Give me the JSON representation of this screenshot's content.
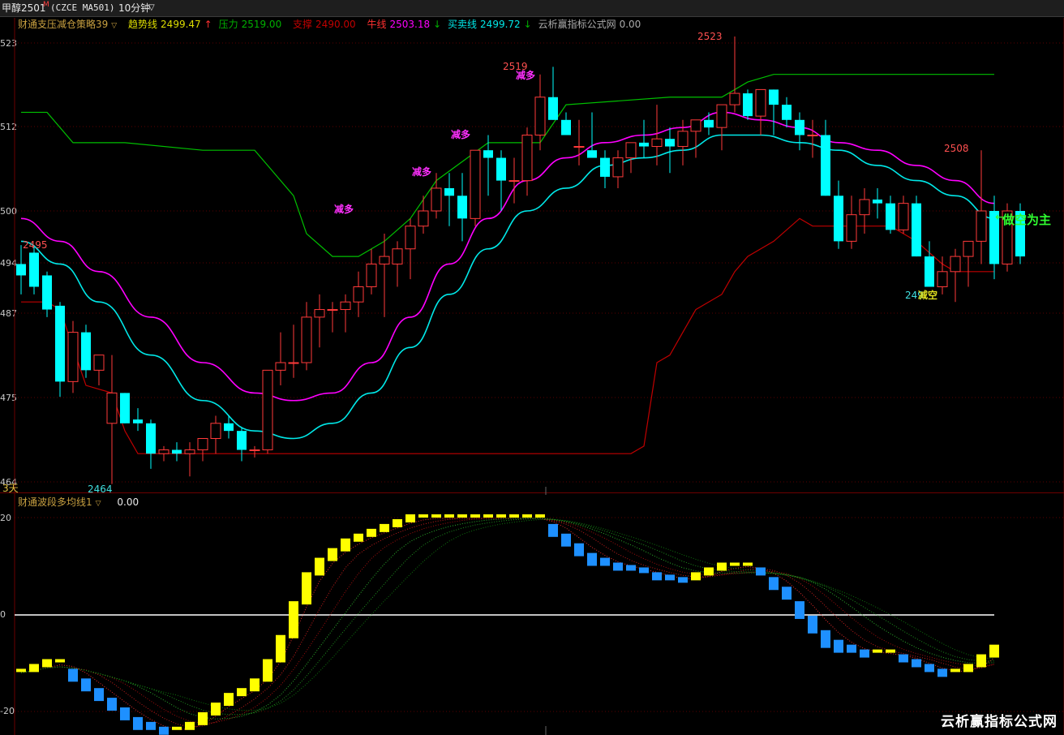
{
  "topbar": {
    "symbol": "甲醇2501",
    "badge": "M",
    "code": "(CZCE MA501)",
    "period": "10分钟"
  },
  "legend_main": {
    "name": "财通支压减仓策略39",
    "trend_label": "趋势线",
    "trend_value": "2499.47",
    "resist_label": "压力",
    "resist_value": "2519.00",
    "support_label": "支撑",
    "support_value": "2490.00",
    "bull_label": "牛线",
    "bull_value": "2503.18",
    "trade_label": "买卖线",
    "trade_value": "2499.72",
    "source_label": "云析赢指标公式网",
    "source_value": "0.00"
  },
  "legend_sub": {
    "name": "财通波段多均线1",
    "value": "0.00"
  },
  "ylabels_main": [
    "523",
    "512",
    "500",
    "494",
    "487",
    "475",
    "464"
  ],
  "ylabels_sub": [
    "20",
    "0",
    "-20"
  ],
  "annotations": {
    "high_2495": "2495",
    "low_2464": "2464",
    "high_2519": "2519",
    "high_2523": "2523",
    "high_2508": "2508",
    "low_right": "249",
    "reduce_long": "减多",
    "reduce_short": "减空",
    "short_main": "做空为主",
    "days": "3天"
  },
  "watermark": "云析赢指标公式网",
  "colors": {
    "up": "#ff3a3a",
    "down": "#00ffff",
    "trend": "#00c000",
    "resist": "#c00000",
    "bull": "#ff00ff",
    "trade": "#00e8e8",
    "barUp": "#ffff00",
    "barDown": "#1e90ff"
  },
  "chart_data": {
    "type": "candlestick",
    "ohlc": [
      [
        2493,
        2495.5,
        2489,
        2491.5
      ],
      [
        2494.5,
        2495.5,
        2489,
        2490
      ],
      [
        2491.5,
        2492,
        2486,
        2487
      ],
      [
        2487.5,
        2488,
        2475.5,
        2477.5
      ],
      [
        2477.5,
        2485.5,
        2476,
        2484
      ],
      [
        2484,
        2485,
        2478,
        2479
      ],
      [
        2479,
        2480,
        2477,
        2481
      ],
      [
        2472,
        2481,
        2464,
        2476
      ],
      [
        2476,
        2476,
        2472,
        2472
      ],
      [
        2472.5,
        2474,
        2471,
        2472
      ],
      [
        2472,
        2472.5,
        2466,
        2468
      ],
      [
        2468,
        2469,
        2467,
        2468.5
      ],
      [
        2468.5,
        2469.5,
        2467,
        2468
      ],
      [
        2468,
        2469.5,
        2465,
        2468.5
      ],
      [
        2468.5,
        2470,
        2467,
        2470
      ],
      [
        2470,
        2473,
        2468,
        2472
      ],
      [
        2472,
        2473,
        2470,
        2471
      ],
      [
        2471,
        2471.5,
        2467,
        2468.5
      ],
      [
        2468.5,
        2469,
        2467.5,
        2468.5
      ],
      [
        2468.5,
        2479,
        2468,
        2479
      ],
      [
        2479,
        2484,
        2477,
        2480
      ],
      [
        2480,
        2485,
        2478,
        2480
      ],
      [
        2480,
        2488,
        2479,
        2486
      ],
      [
        2486,
        2489,
        2482,
        2487
      ],
      [
        2487,
        2488,
        2484,
        2487
      ],
      [
        2487,
        2489,
        2484,
        2488
      ],
      [
        2488,
        2492,
        2486,
        2490
      ],
      [
        2490,
        2495,
        2489,
        2493
      ],
      [
        2493,
        2497,
        2486,
        2494
      ],
      [
        2493,
        2496,
        2490,
        2495
      ],
      [
        2495,
        2499,
        2491,
        2498
      ],
      [
        2498,
        2502,
        2497,
        2500
      ],
      [
        2500,
        2505,
        2499,
        2503
      ],
      [
        2503,
        2505,
        2498,
        2502
      ],
      [
        2502,
        2505,
        2496,
        2499
      ],
      [
        2499,
        2506,
        2498,
        2508
      ],
      [
        2508,
        2510,
        2502,
        2507
      ],
      [
        2507,
        2508,
        2500,
        2504
      ],
      [
        2504,
        2507,
        2501,
        2504
      ],
      [
        2504,
        2511,
        2502,
        2510
      ],
      [
        2510,
        2518,
        2508,
        2515
      ],
      [
        2515,
        2519,
        2512,
        2512
      ],
      [
        2512,
        2513,
        2510,
        2510
      ],
      [
        2508.5,
        2512,
        2506,
        2508.5
      ],
      [
        2508,
        2513,
        2508,
        2507
      ],
      [
        2507,
        2508,
        2503,
        2504.5
      ],
      [
        2504.5,
        2508,
        2503,
        2507
      ],
      [
        2507,
        2509,
        2505,
        2509
      ],
      [
        2509,
        2512,
        2507,
        2508.5
      ],
      [
        2508.5,
        2514,
        2506,
        2509.5
      ],
      [
        2509.5,
        2511,
        2505,
        2508.5
      ],
      [
        2508.5,
        2512,
        2506,
        2510.5
      ],
      [
        2510.5,
        2512,
        2507,
        2512
      ],
      [
        2512,
        2513,
        2510,
        2511
      ],
      [
        2511,
        2514,
        2508,
        2514
      ],
      [
        2514,
        2523,
        2513,
        2515.5
      ],
      [
        2515.5,
        2516,
        2512,
        2512.5
      ],
      [
        2512.5,
        2516,
        2510,
        2516
      ],
      [
        2516,
        2516,
        2510,
        2514
      ],
      [
        2514,
        2515,
        2511,
        2512
      ],
      [
        2512,
        2513,
        2508,
        2510
      ],
      [
        2510,
        2512,
        2507,
        2510
      ],
      [
        2510,
        2512,
        2502,
        2502
      ],
      [
        2502,
        2504,
        2495,
        2496
      ],
      [
        2496,
        2502,
        2495,
        2499.5
      ],
      [
        2499.5,
        2503,
        2497,
        2501.5
      ],
      [
        2501.5,
        2503,
        2499,
        2501
      ],
      [
        2501,
        2502,
        2497,
        2497.5
      ],
      [
        2497.5,
        2502,
        2497,
        2501
      ],
      [
        2501,
        2502,
        2494,
        2494
      ],
      [
        2494,
        2496,
        2490,
        2490
      ],
      [
        2490,
        2494,
        2489,
        2492
      ],
      [
        2492,
        2495,
        2488,
        2494
      ],
      [
        2494,
        2496,
        2490,
        2496
      ],
      [
        2496,
        2508,
        2493,
        2500
      ],
      [
        2500,
        2502,
        2491,
        2493
      ],
      [
        2493,
        2501,
        2492,
        2500
      ],
      [
        2500,
        2501,
        2493,
        2494
      ]
    ],
    "trend_line": [
      [
        0,
        2513
      ],
      [
        2,
        2513
      ],
      [
        4,
        2509
      ],
      [
        8,
        2509
      ],
      [
        14,
        2508
      ],
      [
        18,
        2508
      ],
      [
        19,
        2506
      ],
      [
        21,
        2502
      ],
      [
        22,
        2497
      ],
      [
        24,
        2494
      ],
      [
        26,
        2494
      ],
      [
        28,
        2496
      ],
      [
        30,
        2499
      ],
      [
        32,
        2504
      ],
      [
        36,
        2509
      ],
      [
        40,
        2509
      ],
      [
        42,
        2514
      ],
      [
        50,
        2515
      ],
      [
        54,
        2515
      ],
      [
        56,
        2517
      ],
      [
        58,
        2518
      ],
      [
        75,
        2518
      ]
    ],
    "resist_line": [
      [
        0,
        2488
      ],
      [
        2,
        2488
      ],
      [
        3,
        2487
      ],
      [
        5,
        2477
      ],
      [
        7,
        2476
      ],
      [
        8,
        2471
      ],
      [
        9,
        2468
      ],
      [
        47,
        2468
      ],
      [
        48,
        2469
      ],
      [
        49,
        2480
      ],
      [
        50,
        2481
      ],
      [
        51,
        2484
      ],
      [
        52,
        2487
      ],
      [
        54,
        2489
      ],
      [
        55,
        2492
      ],
      [
        56,
        2494
      ],
      [
        58,
        2496
      ],
      [
        60,
        2499
      ],
      [
        61,
        2498
      ],
      [
        63,
        2498
      ],
      [
        67,
        2498
      ],
      [
        69,
        2496
      ],
      [
        71,
        2493
      ],
      [
        72,
        2492
      ],
      [
        75,
        2492
      ]
    ],
    "bull_line": [
      [
        0,
        2499
      ],
      [
        3,
        2496
      ],
      [
        6,
        2492
      ],
      [
        10,
        2486
      ],
      [
        14,
        2480
      ],
      [
        18,
        2476
      ],
      [
        21,
        2475
      ],
      [
        24,
        2476
      ],
      [
        27,
        2480
      ],
      [
        30,
        2486
      ],
      [
        33,
        2493
      ],
      [
        36,
        2499
      ],
      [
        39,
        2504
      ],
      [
        42,
        2507
      ],
      [
        45,
        2509
      ],
      [
        48,
        2510
      ],
      [
        51,
        2511
      ],
      [
        54,
        2513
      ],
      [
        57,
        2512
      ],
      [
        60,
        2511
      ],
      [
        63,
        2509
      ],
      [
        66,
        2508
      ],
      [
        69,
        2506
      ],
      [
        72,
        2504
      ],
      [
        75,
        2501
      ]
    ],
    "trade_line": [
      [
        0,
        2496
      ],
      [
        3,
        2493
      ],
      [
        6,
        2488
      ],
      [
        10,
        2481
      ],
      [
        14,
        2475
      ],
      [
        18,
        2471
      ],
      [
        21,
        2470
      ],
      [
        24,
        2472
      ],
      [
        27,
        2476
      ],
      [
        30,
        2482
      ],
      [
        33,
        2489
      ],
      [
        36,
        2495
      ],
      [
        39,
        2500
      ],
      [
        42,
        2503
      ],
      [
        45,
        2506
      ],
      [
        48,
        2507
      ],
      [
        51,
        2508
      ],
      [
        54,
        2510
      ],
      [
        57,
        2510
      ],
      [
        60,
        2509
      ],
      [
        63,
        2508
      ],
      [
        66,
        2506
      ],
      [
        69,
        2504
      ],
      [
        72,
        2502
      ],
      [
        75,
        2499
      ]
    ],
    "wave": [
      -12,
      -11,
      -10,
      -10,
      -12,
      -14,
      -16,
      -18,
      -20,
      -22,
      -23,
      -24,
      -24,
      -23,
      -21,
      -19,
      -17,
      -16,
      -14,
      -10,
      -5,
      2,
      8,
      11,
      13,
      15,
      16,
      17,
      18,
      19,
      20,
      20,
      20,
      20,
      20,
      20,
      20,
      20,
      20,
      20,
      20,
      18,
      16,
      14,
      12,
      11,
      10,
      9.5,
      9,
      8,
      7.5,
      7,
      8,
      9,
      10,
      10,
      10,
      9,
      7,
      5,
      2,
      -1,
      -4,
      -6,
      -7,
      -8,
      -8,
      -8,
      -9,
      -10,
      -11,
      -12,
      -12,
      -11,
      -9,
      -7
    ]
  }
}
